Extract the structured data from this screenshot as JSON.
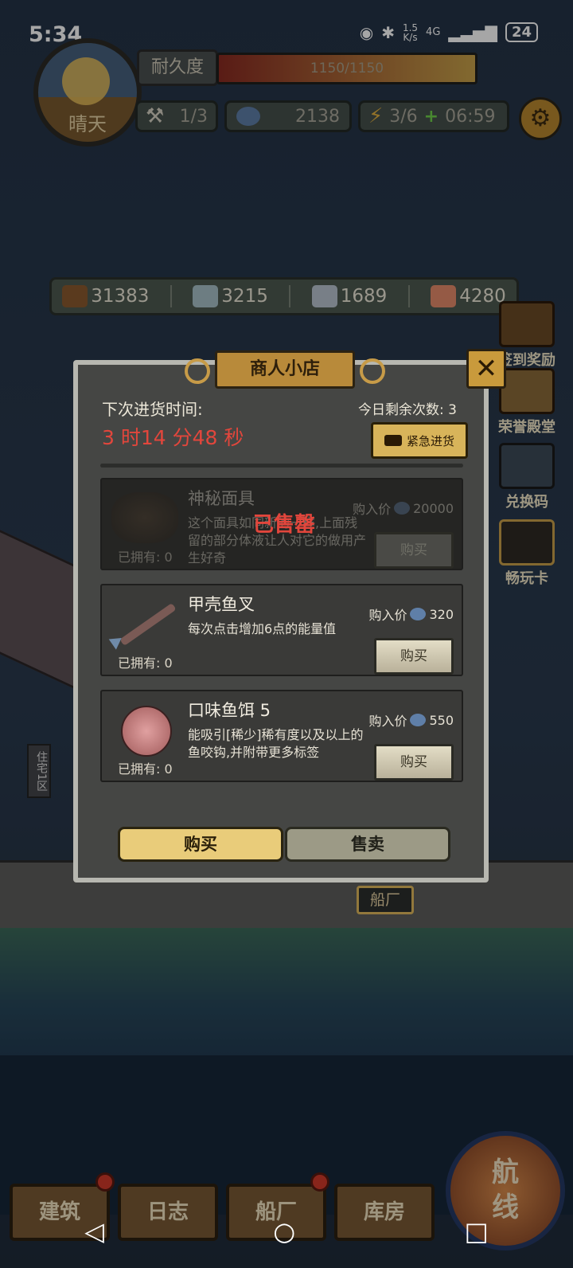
{
  "status_bar": {
    "time": "5:34",
    "speed_top": "1.5",
    "speed_unit": "K/s",
    "network": "4G",
    "battery": "24"
  },
  "hud": {
    "weather_label": "晴天",
    "durability_label": "耐久度",
    "durability_text": "1150/1150",
    "durability_fraction": 1.0,
    "hammer_count": "1/3",
    "shell_count": "2138",
    "energy_count": "3/6",
    "energy_plus": "+",
    "energy_timer": "06:59",
    "settings_icon": "gear-icon"
  },
  "resources": [
    {
      "icon": "wood-log-icon",
      "value": "31383",
      "color": "#8a5a2e"
    },
    {
      "icon": "wood-stump-icon",
      "value": "3215",
      "color": "#a8c0c8"
    },
    {
      "icon": "metal-ingot-icon",
      "value": "1689",
      "color": "#b8c4d0"
    },
    {
      "icon": "fish-meat-icon",
      "value": "4280",
      "color": "#e58a6a"
    }
  ],
  "side_buttons": [
    {
      "label": "签到奖励",
      "icon": "treasure-chest-icon"
    },
    {
      "label": "荣誉殿堂",
      "icon": "podium-icon"
    },
    {
      "label": "兑换码",
      "icon": "ticket-icon"
    },
    {
      "label": "畅玩卡",
      "icon": "card-icon"
    }
  ],
  "shop": {
    "title": "商人小店",
    "restock_label": "下次进货时间:",
    "restock_time": "3 时14 分48 秒",
    "remaining_label": "今日剩余次数: 3",
    "urgent_label": "紧急进货",
    "items": [
      {
        "name": "神秘面具",
        "desc": "这个面具如同新的一样,上面残留的部分体液让人对它的做用产生好奇",
        "owned": "已拥有: 0",
        "price_label": "购入价",
        "price": "20000",
        "buy": "购买",
        "sold_out": "已售罄"
      },
      {
        "name": "甲壳鱼叉",
        "desc": "每次点击增加6点的能量值",
        "owned": "已拥有: 0",
        "price_label": "购入价",
        "price": "320",
        "buy": "购买"
      },
      {
        "name": "口味鱼饵 5",
        "desc": "能吸引[稀少]稀有度以及以上的鱼咬钩,并附带更多标签",
        "owned": "已拥有: 0",
        "price_label": "购入价",
        "price": "550",
        "buy": "购买"
      }
    ],
    "tab_buy": "购买",
    "tab_sell": "售卖"
  },
  "scene": {
    "district_sign": "住宅1区",
    "dock_label": "船厂"
  },
  "bottom_nav": [
    {
      "label": "建筑",
      "dot": true
    },
    {
      "label": "日志",
      "dot": false
    },
    {
      "label": "船厂",
      "dot": true
    },
    {
      "label": "库房",
      "dot": false
    }
  ],
  "route_label": "航线"
}
